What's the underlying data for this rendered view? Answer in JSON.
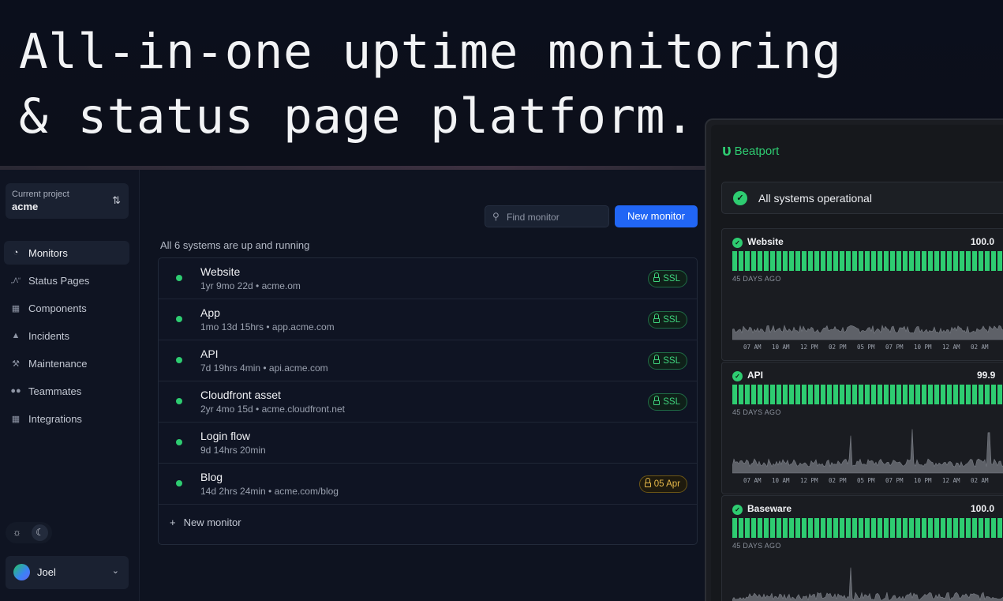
{
  "hero": {
    "line1": "All-in-one uptime monitoring",
    "line2": "& status page platform."
  },
  "sidebar": {
    "project_label": "Current project",
    "project_value": "acme",
    "project_switch_icon": "arrows-up-down-icon",
    "items": [
      {
        "label": "Monitors",
        "icon": "monitor-pie-icon",
        "active": true
      },
      {
        "label": "Status Pages",
        "icon": "broadcast-icon",
        "active": false
      },
      {
        "label": "Components",
        "icon": "puzzle-icon",
        "active": false
      },
      {
        "label": "Incidents",
        "icon": "cone-icon",
        "active": false
      },
      {
        "label": "Maintenance",
        "icon": "wrench-icon",
        "active": false
      },
      {
        "label": "Teammates",
        "icon": "users-icon",
        "active": false
      },
      {
        "label": "Integrations",
        "icon": "grid-icon",
        "active": false
      }
    ],
    "user_name": "Joel"
  },
  "main": {
    "search_placeholder": "Find monitor",
    "new_monitor_button": "New monitor",
    "summary": "All 6 systems are up and running",
    "monitors": [
      {
        "name": "Website",
        "meta": "1yr 9mo 22d • acme.om",
        "badge": "SSL",
        "badge_type": "ssl"
      },
      {
        "name": "App",
        "meta": "1mo 13d 15hrs • app.acme.com",
        "badge": "SSL",
        "badge_type": "ssl"
      },
      {
        "name": "API",
        "meta": "7d 19hrs 4min • api.acme.com",
        "badge": "SSL",
        "badge_type": "ssl"
      },
      {
        "name": "Cloudfront asset",
        "meta": "2yr 4mo 15d • acme.cloudfront.net",
        "badge": "SSL",
        "badge_type": "ssl"
      },
      {
        "name": "Login flow",
        "meta": "9d 14hrs 20min",
        "badge": "",
        "badge_type": "none"
      },
      {
        "name": "Blog",
        "meta": "14d 2hrs 24min • acme.com/blog",
        "badge": "05 Apr",
        "badge_type": "expiring"
      }
    ],
    "add_monitor": "New monitor"
  },
  "status_page": {
    "brand": "Beatport",
    "banner": "All systems operational",
    "days_ago": "45 DAYS AGO",
    "ticks": [
      "07 AM",
      "10 AM",
      "12 PM",
      "02 PM",
      "05 PM",
      "07 PM",
      "10 PM",
      "12 AM",
      "02 AM"
    ],
    "services": [
      {
        "name": "Website",
        "uptime": "100.0"
      },
      {
        "name": "API",
        "uptime": "99.9"
      },
      {
        "name": "Baseware",
        "uptime": "100.0"
      }
    ]
  },
  "colors": {
    "up": "#2ecc71",
    "accent": "#2166f5",
    "warning": "#e6b84a",
    "background": "#0e1320"
  }
}
